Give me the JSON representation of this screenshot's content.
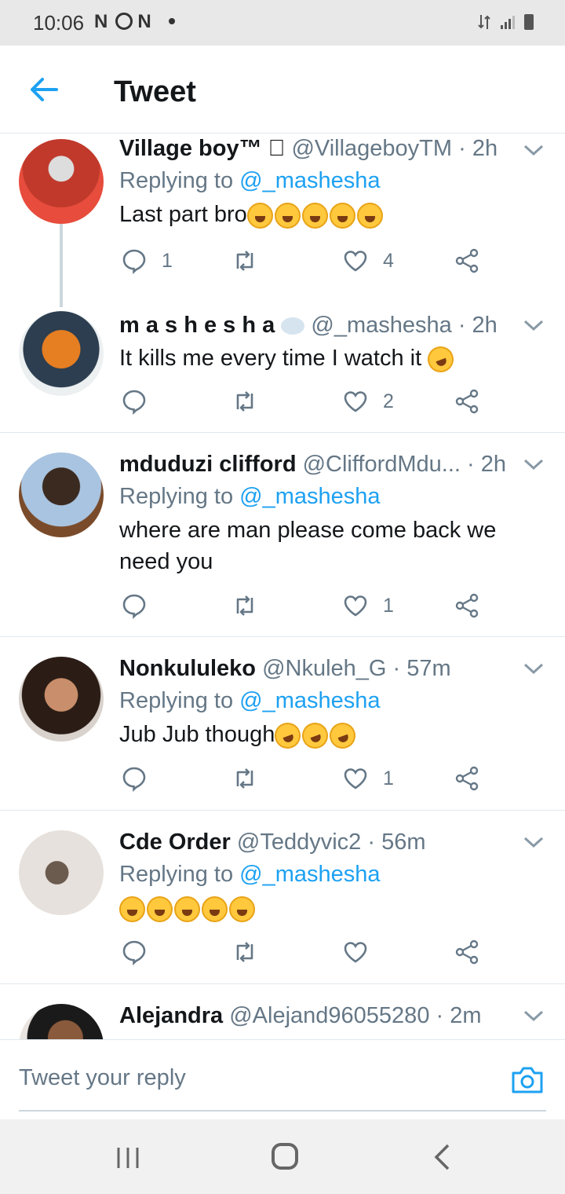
{
  "status_bar": {
    "time": "10:06",
    "left_icons": "N",
    "left_icons_2": "N"
  },
  "header": {
    "title": "Tweet"
  },
  "tweets": [
    {
      "name": "Village boy™ ⃠",
      "handle": "@VillageboyTM",
      "time": "· 2h",
      "replying_prefix": "Replying to",
      "replying_to": "@_mashesha",
      "text": "Last part bro",
      "emoji_count": 5,
      "replies": "1",
      "retweets": "",
      "likes": "4"
    },
    {
      "name": "m a s h e s h a",
      "handle": "@_mashesha",
      "time": "· 2h",
      "text": "It kills me every time I watch it",
      "replies": "",
      "retweets": "",
      "likes": "2"
    },
    {
      "name": "mduduzi clifford",
      "handle": "@CliffordMdu...",
      "time": "· 2h",
      "replying_prefix": "Replying to",
      "replying_to": "@_mashesha",
      "text": "where are man please come back we need you",
      "replies": "",
      "retweets": "",
      "likes": "1"
    },
    {
      "name": "Nonkululeko",
      "handle": "@Nkuleh_G",
      "time": "· 57m",
      "replying_prefix": "Replying to",
      "replying_to": "@_mashesha",
      "text": "Jub Jub though",
      "emoji_count": 3,
      "replies": "",
      "retweets": "",
      "likes": "1"
    },
    {
      "name": "Cde Order",
      "handle": "@Teddyvic2",
      "time": "· 56m",
      "replying_prefix": "Replying to",
      "replying_to": "@_mashesha",
      "text": "",
      "emoji_count": 5,
      "replies": "",
      "retweets": "",
      "likes": ""
    },
    {
      "name": "Alejandra",
      "handle": "@Alejand96055280",
      "time": "· 2m"
    }
  ],
  "reply_bar": {
    "placeholder": "Tweet your reply"
  },
  "icons": {
    "back": "arrow-left-icon",
    "reply": "speech-bubble-icon",
    "retweet": "retweet-icon",
    "like": "heart-icon",
    "share": "share-icon",
    "more": "chevron-down-icon",
    "camera": "camera-icon"
  },
  "colors": {
    "accent": "#1da1f2",
    "text": "#14171a",
    "meta": "#657786",
    "divider": "#e1e8ed"
  }
}
